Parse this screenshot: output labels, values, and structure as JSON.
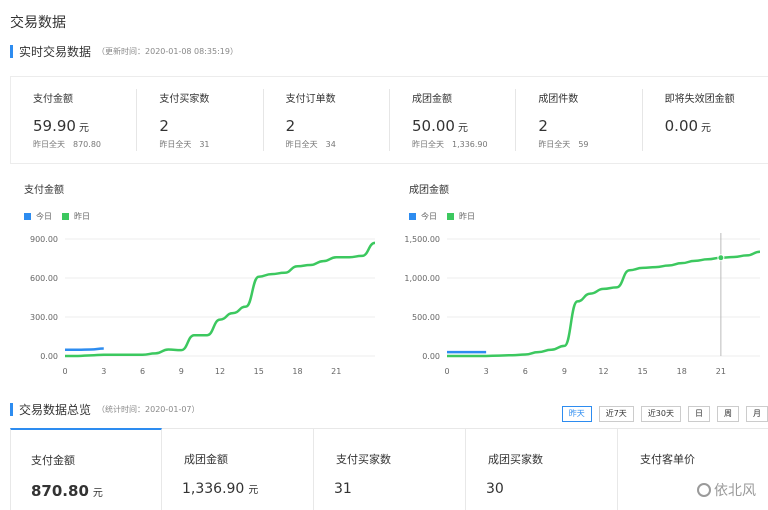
{
  "page": {
    "title": "交易数据"
  },
  "realtime": {
    "title": "实时交易数据",
    "note": "（更新时间：2020-01-08 08:35:19）"
  },
  "stats": [
    {
      "label": "支付金额",
      "value": "59.90",
      "unit": "元",
      "yest_label": "昨日全天",
      "yest_value": "870.80"
    },
    {
      "label": "支付买家数",
      "value": "2",
      "unit": "",
      "yest_label": "昨日全天",
      "yest_value": "31"
    },
    {
      "label": "支付订单数",
      "value": "2",
      "unit": "",
      "yest_label": "昨日全天",
      "yest_value": "34"
    },
    {
      "label": "成团金额",
      "value": "50.00",
      "unit": "元",
      "yest_label": "昨日全天",
      "yest_value": "1,336.90"
    },
    {
      "label": "成团件数",
      "value": "2",
      "unit": "",
      "yest_label": "昨日全天",
      "yest_value": "59"
    },
    {
      "label": "即将失效团金额",
      "value": "0.00",
      "unit": "元",
      "yest_label": "",
      "yest_value": ""
    }
  ],
  "legend": {
    "today": "今日",
    "yesterday": "昨日"
  },
  "colors": {
    "today": "#2d8cf0",
    "yesterday": "#3cc85f",
    "accent": "#2d8cf0"
  },
  "chart_data": [
    {
      "type": "line",
      "title": "支付金额",
      "x_ticks": [
        "0",
        "3",
        "6",
        "9",
        "12",
        "15",
        "18",
        "21"
      ],
      "y_ticks": [
        "0.00",
        "300.00",
        "600.00",
        "900.00"
      ],
      "ylim": [
        0,
        900
      ],
      "xlim": [
        0,
        24
      ],
      "series": [
        {
          "name": "今日",
          "color": "#2d8cf0",
          "x": [
            0,
            1,
            2,
            3
          ],
          "y": [
            48,
            48,
            50,
            58
          ]
        },
        {
          "name": "昨日",
          "color": "#3cc85f",
          "x": [
            0,
            1,
            2,
            3,
            4,
            5,
            6,
            7,
            8,
            9,
            10,
            11,
            12,
            13,
            14,
            15,
            16,
            17,
            18,
            19,
            20,
            21,
            22,
            23,
            24
          ],
          "y": [
            0,
            0,
            5,
            10,
            10,
            10,
            10,
            20,
            50,
            45,
            160,
            160,
            280,
            330,
            380,
            610,
            630,
            640,
            690,
            700,
            730,
            760,
            760,
            770,
            870
          ]
        }
      ]
    },
    {
      "type": "line",
      "title": "成团金额",
      "x_ticks": [
        "0",
        "3",
        "6",
        "9",
        "12",
        "15",
        "18",
        "21"
      ],
      "y_ticks": [
        "0.00",
        "500.00",
        "1,000.00",
        "1,500.00"
      ],
      "ylim": [
        0,
        1500
      ],
      "xlim": [
        0,
        24
      ],
      "marker_x": 21,
      "series": [
        {
          "name": "今日",
          "color": "#2d8cf0",
          "x": [
            0,
            1,
            2,
            3
          ],
          "y": [
            50,
            50,
            50,
            50
          ]
        },
        {
          "name": "昨日",
          "color": "#3cc85f",
          "x": [
            0,
            1,
            2,
            3,
            4,
            5,
            6,
            7,
            8,
            9,
            10,
            11,
            12,
            13,
            14,
            15,
            16,
            17,
            18,
            19,
            20,
            21,
            22,
            23,
            24
          ],
          "y": [
            0,
            0,
            0,
            0,
            5,
            10,
            20,
            50,
            80,
            130,
            700,
            800,
            860,
            880,
            1100,
            1130,
            1140,
            1160,
            1190,
            1220,
            1240,
            1260,
            1270,
            1290,
            1337
          ]
        }
      ]
    }
  ],
  "overview": {
    "title": "交易数据总览",
    "note": "（统计时间：2020-01-07）"
  },
  "ranges": [
    {
      "label": "昨天",
      "active": true
    },
    {
      "label": "近7天",
      "active": false
    },
    {
      "label": "近30天",
      "active": false
    },
    {
      "label": "日",
      "active": false
    },
    {
      "label": "周",
      "active": false
    },
    {
      "label": "月",
      "active": false
    }
  ],
  "ov_cards": [
    {
      "label": "支付金额",
      "value": "870.80",
      "unit": "元",
      "active": true
    },
    {
      "label": "成团金额",
      "value": "1,336.90",
      "unit": "元",
      "active": false
    },
    {
      "label": "支付买家数",
      "value": "31",
      "unit": "",
      "active": false
    },
    {
      "label": "成团买家数",
      "value": "30",
      "unit": "",
      "active": false
    },
    {
      "label": "支付客单价",
      "value": "",
      "unit": "",
      "active": false
    }
  ],
  "watermark": {
    "text": "依北风"
  }
}
